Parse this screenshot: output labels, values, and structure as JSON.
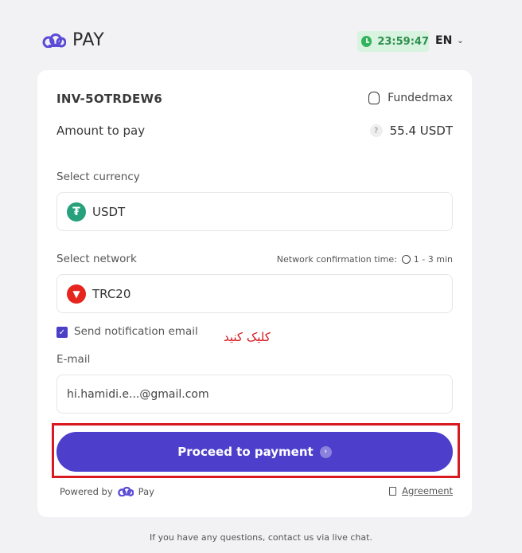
{
  "header": {
    "logo_text": "PAY",
    "timer": "23:59:47",
    "language": "EN"
  },
  "invoice": {
    "id": "INV-5OTRDEW6",
    "merchant": "Fundedmax",
    "amount_label": "Amount to pay",
    "amount_value": "55.4 USDT"
  },
  "currency": {
    "label": "Select currency",
    "selected": "USDT",
    "icon": "tether-icon",
    "color": "#26a17b"
  },
  "network": {
    "label": "Select network",
    "confirmation_label": "Network confirmation time:",
    "confirmation_time": "1 - 3 min",
    "selected": "TRC20",
    "icon": "tron-icon",
    "color": "#e5251e"
  },
  "notification": {
    "checked": true,
    "label": "Send notification email"
  },
  "email": {
    "label": "E-mail",
    "value": "hi.hamidi.e...@gmail.com"
  },
  "annotation": {
    "text": "کلیک کنید",
    "color": "#d8191f"
  },
  "proceed_button": {
    "label": "Proceed to payment",
    "color": "#4d3fcb"
  },
  "footer": {
    "powered_by": "Powered by",
    "powered_brand": "Pay",
    "agreement": "Agreement",
    "help_text": "If you have any questions, contact us via live chat."
  }
}
